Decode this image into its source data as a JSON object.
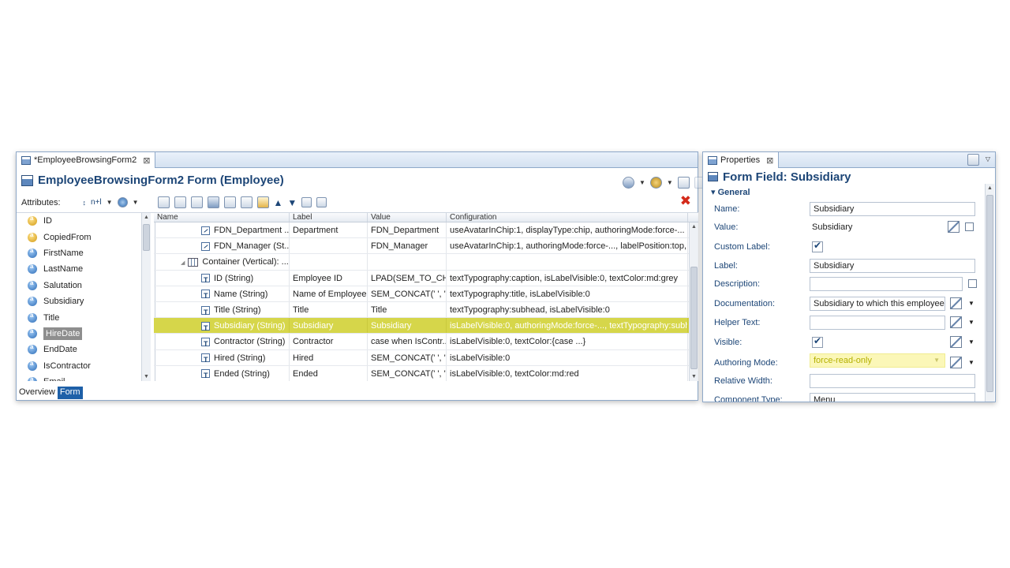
{
  "editor": {
    "tab_title": "*EmployeeBrowsingForm2",
    "form_title": "EmployeeBrowsingForm2 Form (Employee)",
    "attributes_label": "Attributes:",
    "sort_label": "n+l",
    "bottom_tabs": [
      "Overview",
      "Form"
    ],
    "active_bottom_tab": "Form",
    "attributes": [
      {
        "name": "ID",
        "kind": "key"
      },
      {
        "name": "CopiedFrom",
        "kind": "key"
      },
      {
        "name": "FirstName",
        "kind": "attr"
      },
      {
        "name": "LastName",
        "kind": "attr"
      },
      {
        "name": "Salutation",
        "kind": "attr"
      },
      {
        "name": "Subsidiary",
        "kind": "attr"
      },
      {
        "name": "Title",
        "kind": "attr"
      },
      {
        "name": "HireDate",
        "kind": "attr",
        "selected": true
      },
      {
        "name": "EndDate",
        "kind": "attr"
      },
      {
        "name": "IsContractor",
        "kind": "attr"
      },
      {
        "name": "Email",
        "kind": "attr"
      }
    ],
    "columns": [
      "Name",
      "Label",
      "Value",
      "Configuration"
    ],
    "rows": [
      {
        "icon": "chip",
        "indent": 2,
        "name": "FDN_Department ...",
        "label": "Department",
        "value": "FDN_Department",
        "conf": "useAvatarInChip:1, displayType:chip, authoringMode:force-..."
      },
      {
        "icon": "chip",
        "indent": 2,
        "name": "FDN_Manager (St...",
        "label": "",
        "value": "FDN_Manager",
        "conf": "useAvatarInChip:1, authoringMode:force-..., labelPosition:top, di..."
      },
      {
        "icon": "ctr",
        "indent": 1,
        "name": "Container (Vertical): ...",
        "label": "",
        "value": "",
        "conf": ""
      },
      {
        "icon": "t",
        "indent": 2,
        "name": "ID (String)",
        "label": "Employee ID",
        "value": "LPAD(SEM_TO_CH...",
        "conf": "textTypography:caption, isLabelVisible:0, textColor:md:grey"
      },
      {
        "icon": "t",
        "indent": 2,
        "name": "Name (String)",
        "label": "Name of Employee",
        "value": "SEM_CONCAT(' ', '...",
        "conf": "textTypography:title, isLabelVisible:0"
      },
      {
        "icon": "t",
        "indent": 2,
        "name": "Title (String)",
        "label": "Title",
        "value": "Title",
        "conf": "textTypography:subhead, isLabelVisible:0"
      },
      {
        "icon": "t",
        "indent": 2,
        "name": "Subsidiary (String)",
        "label": "Subsidiary",
        "value": "Subsidiary",
        "conf": "isLabelVisible:0, authoringMode:force-..., textTypography:subhead",
        "highlight": true
      },
      {
        "icon": "t",
        "indent": 2,
        "name": "Contractor (String)",
        "label": "Contractor",
        "value": "case when IsContr...",
        "conf": "isLabelVisible:0, textColor:{case ...}"
      },
      {
        "icon": "t",
        "indent": 2,
        "name": "Hired (String)",
        "label": "Hired",
        "value": "SEM_CONCAT(' ', '...",
        "conf": "isLabelVisible:0"
      },
      {
        "icon": "t",
        "indent": 2,
        "name": "Ended (String)",
        "label": "Ended",
        "value": "SEM_CONCAT(' ', '...",
        "conf": "isLabelVisible:0, textColor:md:red"
      }
    ]
  },
  "properties": {
    "tab_title": "Properties",
    "heading": "Form Field: Subsidiary",
    "section": "General",
    "name_label": "Name:",
    "name_value": "Subsidiary",
    "value_label": "Value:",
    "value_value": "Subsidiary",
    "custom_label_label": "Custom Label:",
    "label_label": "Label:",
    "label_value": "Subsidiary",
    "description_label": "Description:",
    "description_value": "",
    "documentation_label": "Documentation:",
    "documentation_value": "Subsidiary to which this employee re",
    "helper_label": "Helper Text:",
    "helper_value": "",
    "visible_label": "Visible:",
    "authoring_label": "Authoring Mode:",
    "authoring_value": "force-read-only",
    "relwidth_label": "Relative Width:",
    "relwidth_value": "",
    "component_label": "Component Type:",
    "component_value": "Menu"
  },
  "colors": {
    "highlight": "#d6d64a",
    "title_blue": "#1d4677",
    "active_tab": "#1e60a8",
    "delete_red": "#d42a1a"
  }
}
